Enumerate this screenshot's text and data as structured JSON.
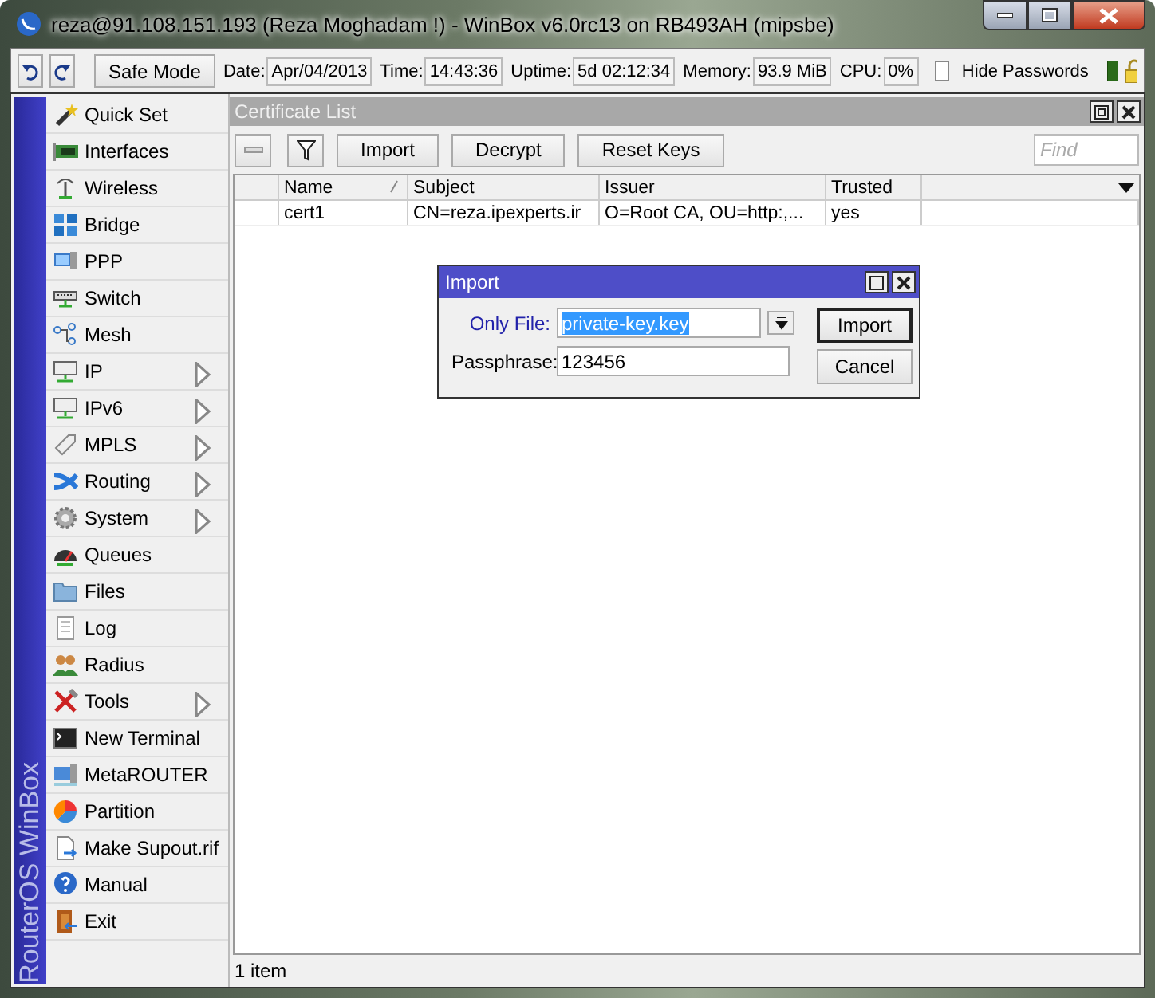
{
  "window": {
    "title": "reza@91.108.151.193 (Reza Moghadam !) - WinBox v6.0rc13 on RB493AH (mipsbe)"
  },
  "toolbar": {
    "safe_mode": "Safe Mode",
    "stats": [
      {
        "label": "Date:",
        "value": "Apr/04/2013"
      },
      {
        "label": "Time:",
        "value": "14:43:36"
      },
      {
        "label": "Uptime:",
        "value": "5d 02:12:34"
      },
      {
        "label": "Memory:",
        "value": "93.9 MiB"
      },
      {
        "label": "CPU:",
        "value": "0%"
      }
    ],
    "hide_passwords": {
      "label": "Hide Passwords",
      "checked": false
    }
  },
  "sidebar": {
    "brand": "RouterOS WinBox",
    "items": [
      {
        "label": "Quick Set",
        "submenu": false
      },
      {
        "label": "Interfaces",
        "submenu": false
      },
      {
        "label": "Wireless",
        "submenu": false
      },
      {
        "label": "Bridge",
        "submenu": false
      },
      {
        "label": "PPP",
        "submenu": false
      },
      {
        "label": "Switch",
        "submenu": false
      },
      {
        "label": "Mesh",
        "submenu": false
      },
      {
        "label": "IP",
        "submenu": true
      },
      {
        "label": "IPv6",
        "submenu": true
      },
      {
        "label": "MPLS",
        "submenu": true
      },
      {
        "label": "Routing",
        "submenu": true
      },
      {
        "label": "System",
        "submenu": true
      },
      {
        "label": "Queues",
        "submenu": false
      },
      {
        "label": "Files",
        "submenu": false
      },
      {
        "label": "Log",
        "submenu": false
      },
      {
        "label": "Radius",
        "submenu": false
      },
      {
        "label": "Tools",
        "submenu": true
      },
      {
        "label": "New Terminal",
        "submenu": false
      },
      {
        "label": "MetaROUTER",
        "submenu": false
      },
      {
        "label": "Partition",
        "submenu": false
      },
      {
        "label": "Make Supout.rif",
        "submenu": false
      },
      {
        "label": "Manual",
        "submenu": false
      },
      {
        "label": "Exit",
        "submenu": false
      }
    ]
  },
  "certificate_list": {
    "title": "Certificate List",
    "buttons": [
      "Import",
      "Decrypt",
      "Reset Keys"
    ],
    "search": {
      "placeholder": "Find"
    },
    "columns": [
      {
        "label": "Name",
        "sorted": true
      },
      {
        "label": "Subject",
        "sorted": false
      },
      {
        "label": "Issuer",
        "sorted": false
      },
      {
        "label": "Trusted",
        "sorted": false
      }
    ],
    "rows": [
      [
        "cert1",
        "CN=reza.ipexperts.ir",
        "O=Root CA, OU=http:,...",
        "yes"
      ]
    ],
    "status": "1 item"
  },
  "import_dialog": {
    "title": "Import",
    "fields": [
      {
        "label": "Only File:",
        "value": "private-key.key",
        "kind": "dropdown",
        "highlighted": true
      },
      {
        "label": "Passphrase:",
        "value": "123456",
        "kind": "text",
        "highlighted": false
      }
    ],
    "buttons": [
      {
        "label": "Import",
        "default": true
      },
      {
        "label": "Cancel",
        "default": false
      }
    ]
  }
}
